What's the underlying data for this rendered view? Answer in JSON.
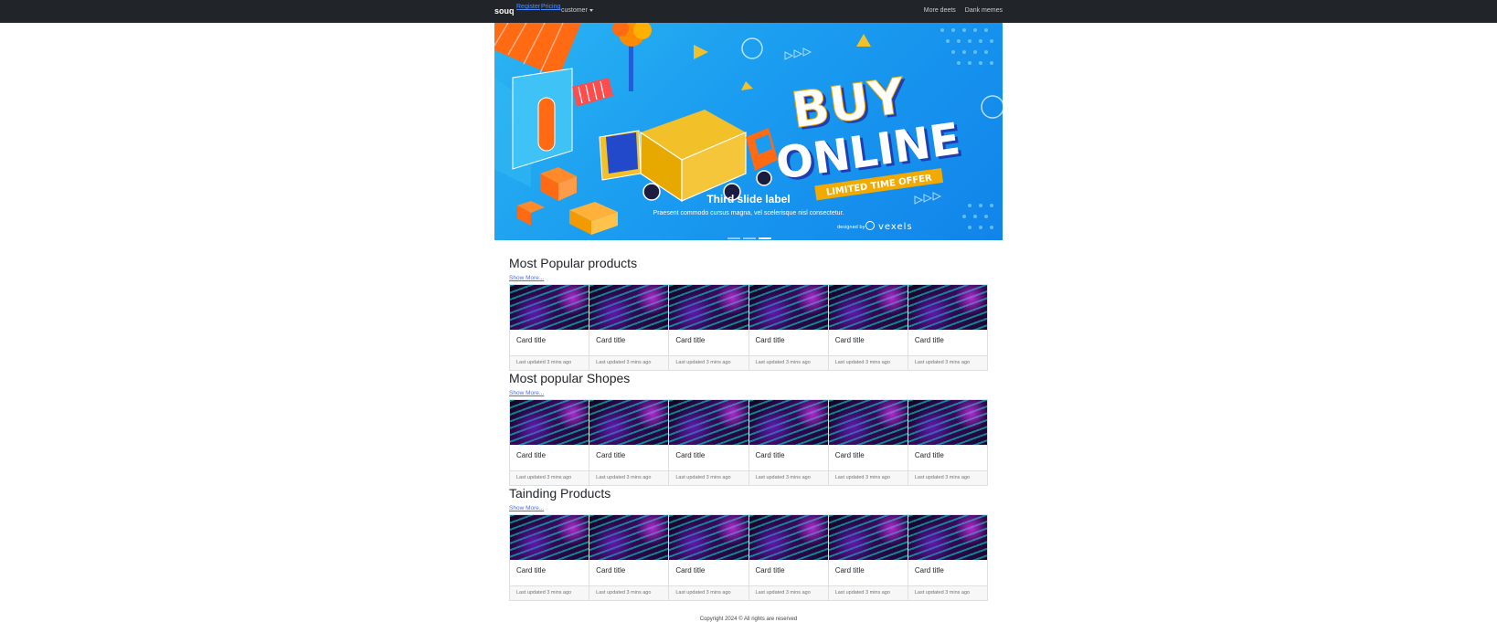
{
  "navbar": {
    "brand": "souq",
    "links": [
      "Register",
      "Pricing"
    ],
    "dropdown_label": "customer",
    "right_links": [
      "More deets",
      "Dank memes"
    ]
  },
  "carousel": {
    "caption_title": "Third slide label",
    "caption_text": "Praesent commodo cursus magna, vel scelerisque nisl consectetur.",
    "active_slide": 3,
    "slide_count": 3,
    "image": {
      "headline_1": "BUY",
      "headline_2": "ONLINE",
      "ribbon": "LIMITED TIME OFFER",
      "credit_prefix": "designed by",
      "credit_brand": "vexels"
    }
  },
  "sections": [
    {
      "title": "Most Popular products",
      "show_more": "Show More...",
      "cards": [
        {
          "title": "Card title",
          "footer": "Last updated 3 mins ago"
        },
        {
          "title": "Card title",
          "footer": "Last updated 3 mins ago"
        },
        {
          "title": "Card title",
          "footer": "Last updated 3 mins ago"
        },
        {
          "title": "Card title",
          "footer": "Last updated 3 mins ago"
        },
        {
          "title": "Card title",
          "footer": "Last updated 3 mins ago"
        },
        {
          "title": "Card title",
          "footer": "Last updated 3 mins ago"
        }
      ]
    },
    {
      "title": "Most popular Shopes",
      "show_more": "Show More...",
      "cards": [
        {
          "title": "Card title",
          "footer": "Last updated 3 mins ago"
        },
        {
          "title": "Card title",
          "footer": "Last updated 3 mins ago"
        },
        {
          "title": "Card title",
          "footer": "Last updated 3 mins ago"
        },
        {
          "title": "Card title",
          "footer": "Last updated 3 mins ago"
        },
        {
          "title": "Card title",
          "footer": "Last updated 3 mins ago"
        },
        {
          "title": "Card title",
          "footer": "Last updated 3 mins ago"
        }
      ]
    },
    {
      "title": "Tainding Products",
      "show_more": "Show More...",
      "cards": [
        {
          "title": "Card title",
          "footer": "Last updated 3 mins ago"
        },
        {
          "title": "Card title",
          "footer": "Last updated 3 mins ago"
        },
        {
          "title": "Card title",
          "footer": "Last updated 3 mins ago"
        },
        {
          "title": "Card title",
          "footer": "Last updated 3 mins ago"
        },
        {
          "title": "Card title",
          "footer": "Last updated 3 mins ago"
        },
        {
          "title": "Card title",
          "footer": "Last updated 3 mins ago"
        }
      ]
    }
  ],
  "footer": {
    "copyright": "Copyright 2024 © All rights are reserved"
  },
  "colors": {
    "navbar_bg": "#212529",
    "link_blue": "#4d6cf0",
    "banner_blue": "#1a9cf0",
    "banner_orange": "#ff6a13",
    "banner_yellow": "#f2b705"
  }
}
